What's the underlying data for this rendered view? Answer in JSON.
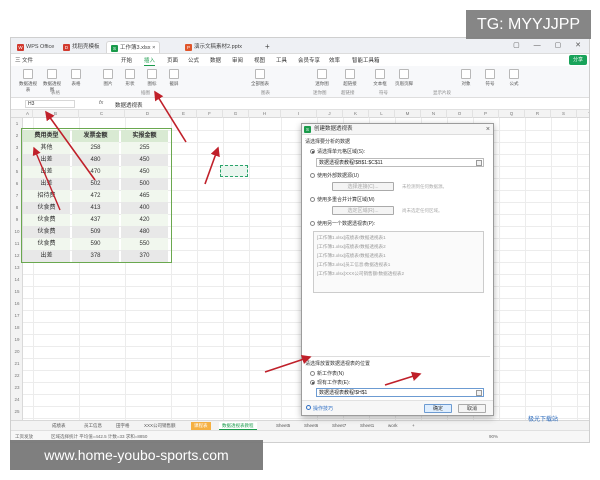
{
  "overlay": {
    "tg_badge": "TG: MYYJJPP",
    "url_badge": "www.home-youbo-sports.com",
    "site_logo": "极光下载站"
  },
  "titlebar": {
    "tabs": [
      {
        "label": "WPS Office",
        "icon_color": "#d23a2e"
      },
      {
        "label": "找稻壳模板",
        "icon_color": "#d23a2e"
      },
      {
        "label": "工作簿3.xlsx",
        "icon_color": "#1a9b4b"
      },
      {
        "label": "演示文稿素材2.pptx",
        "icon_color": "#e0552a"
      }
    ],
    "new_tab": "+"
  },
  "menubar": {
    "items": [
      "三 文件",
      "开始",
      "插入",
      "页面",
      "公式",
      "数据",
      "审阅",
      "视图",
      "工具",
      "会员专享",
      "效率",
      "智能工具箱"
    ],
    "active": "插入",
    "share": "分享"
  },
  "ribbon": {
    "buttons": [
      "数据透视表",
      "数据透视图",
      "表格",
      "图片",
      "形状",
      "图标",
      "截屏",
      "全部图表",
      "迷你图",
      "超链接",
      "文本框",
      "页眉页脚",
      "艺术字",
      "附件",
      "对象",
      "符号",
      "公式"
    ],
    "groups": [
      "表格",
      "插图",
      "图表",
      "迷你图",
      "超链接",
      "符号",
      "显示片段"
    ]
  },
  "formula_bar": {
    "name_box": "H3",
    "fx": "fx",
    "formula": "数据透视表"
  },
  "grid": {
    "columns": [
      "A",
      "B",
      "C",
      "D",
      "E",
      "F",
      "G",
      "H",
      "I",
      "J",
      "K",
      "L",
      "M",
      "N",
      "O",
      "P",
      "Q",
      "R",
      "S",
      "T",
      "U",
      "V"
    ],
    "rows": [
      "1",
      "2",
      "3",
      "4",
      "5",
      "6",
      "7",
      "8",
      "9",
      "10",
      "11",
      "12",
      "13",
      "14",
      "15",
      "16",
      "17",
      "18",
      "19",
      "20",
      "21",
      "22",
      "23",
      "24",
      "25",
      "26"
    ],
    "table_headers": [
      "费用类型",
      "发票金额",
      "实报金额"
    ],
    "table_rows": [
      [
        "其他",
        "258",
        "255"
      ],
      [
        "出差",
        "480",
        "450"
      ],
      [
        "出差",
        "470",
        "450"
      ],
      [
        "出差",
        "502",
        "500"
      ],
      [
        "招待费",
        "472",
        "465"
      ],
      [
        "伙食费",
        "413",
        "400"
      ],
      [
        "伙食费",
        "437",
        "420"
      ],
      [
        "伙食费",
        "509",
        "480"
      ],
      [
        "伙食费",
        "590",
        "550"
      ],
      [
        "出差",
        "378",
        "370"
      ]
    ]
  },
  "sheet_tabs": [
    "成绩表",
    "员工信息",
    "田字格",
    "XXX公司销售额",
    "课程表",
    "数据透视表教程",
    "Sheet5",
    "Sheet6",
    "Sheet7",
    "Sheet1",
    "work",
    "+"
  ],
  "sheet_tabs_active": "数据透视表教程",
  "status": {
    "left": "工资发放",
    "stats": "区域选择统计  平均值=442.5  计数=33  求和=8850",
    "zoom": "90%"
  },
  "dialog": {
    "title": "创建数据透视表",
    "section1": "请选择要分析的数据",
    "opt_range": "请选择单元格区域(S):",
    "range_value": "数据透视表教程!$B$1:$C$11",
    "opt_external": "使用外部数据源(U)",
    "btn_choose_conn": "选择连接(C)...",
    "no_conn": "未检测到任何数据源。",
    "opt_multi": "使用多重合并计算区域(M)",
    "btn_choose_region": "选定区域(R)...",
    "no_region": "尚未选定任何区域。",
    "opt_other": "使用另一个数据透视表(P):",
    "other_list": [
      "[工作簿1.xlsx]成绩表!数据透视表1",
      "[工作簿1.xlsx]成绩表!数据透视表2",
      "[工作簿3.xlsx]成绩表!数据透视表1",
      "[工作簿3.xlsx]员工信息!数据透视表1",
      "[工作簿3.xlsx]XXX公司销售额!数据透视表2"
    ],
    "section2": "请选择放置数据透视表的位置",
    "opt_new_sheet": "新工作表(N)",
    "opt_existing": "现有工作表(E):",
    "existing_value": "数据透视表教程!$H$1",
    "help_link": "操作技巧",
    "ok": "确定",
    "cancel": "取消"
  }
}
